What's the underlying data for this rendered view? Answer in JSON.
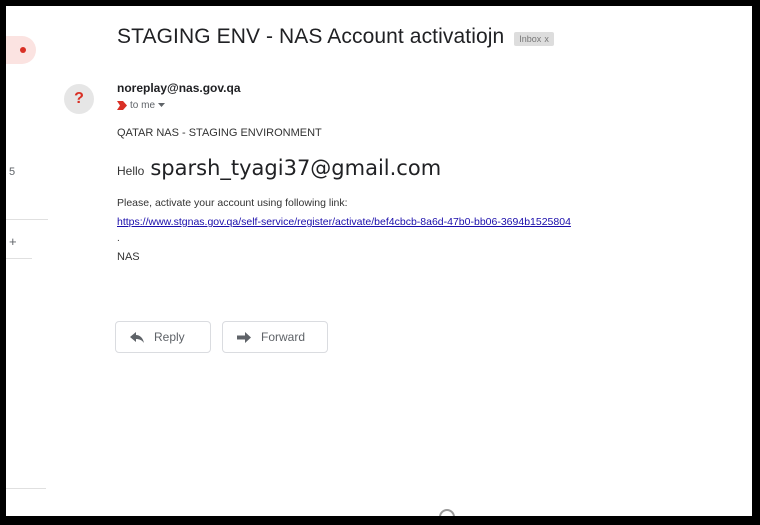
{
  "email": {
    "subject": "STAGING ENV - NAS Account activatiojn",
    "label_chip": "Inbox",
    "label_chip_close": "x",
    "sender": "noreplay@nas.gov.qa",
    "recipient": "to me",
    "body": {
      "header": "QATAR NAS - STAGING ENVIRONMENT",
      "greeting": "Hello",
      "greeting_email": "sparsh_tyagi37@gmail.com",
      "instructions": "Please, activate your account using following link:",
      "link": "https://www.stgnas.gov.qa/self-service/register/activate/bef4cbcb-8a6d-47b0-bb06-3694b1525804",
      "separator": ".",
      "signature": "NAS"
    }
  },
  "actions": {
    "reply_label": "Reply",
    "forward_label": "Forward"
  },
  "sidebar": {
    "count": "5",
    "plus": "+"
  },
  "avatar": {
    "glyph": "?"
  },
  "colors": {
    "link": "#1a0dab",
    "avatar_glyph": "#d93025",
    "importance_marker": "#d93025",
    "chip_bg": "#dddddd"
  },
  "icons": {
    "importance": "importance-marker-icon",
    "dropdown": "chevron-down-icon",
    "reply": "reply-arrow-icon",
    "forward": "forward-arrow-icon",
    "loader": "loading-spinner-icon"
  }
}
